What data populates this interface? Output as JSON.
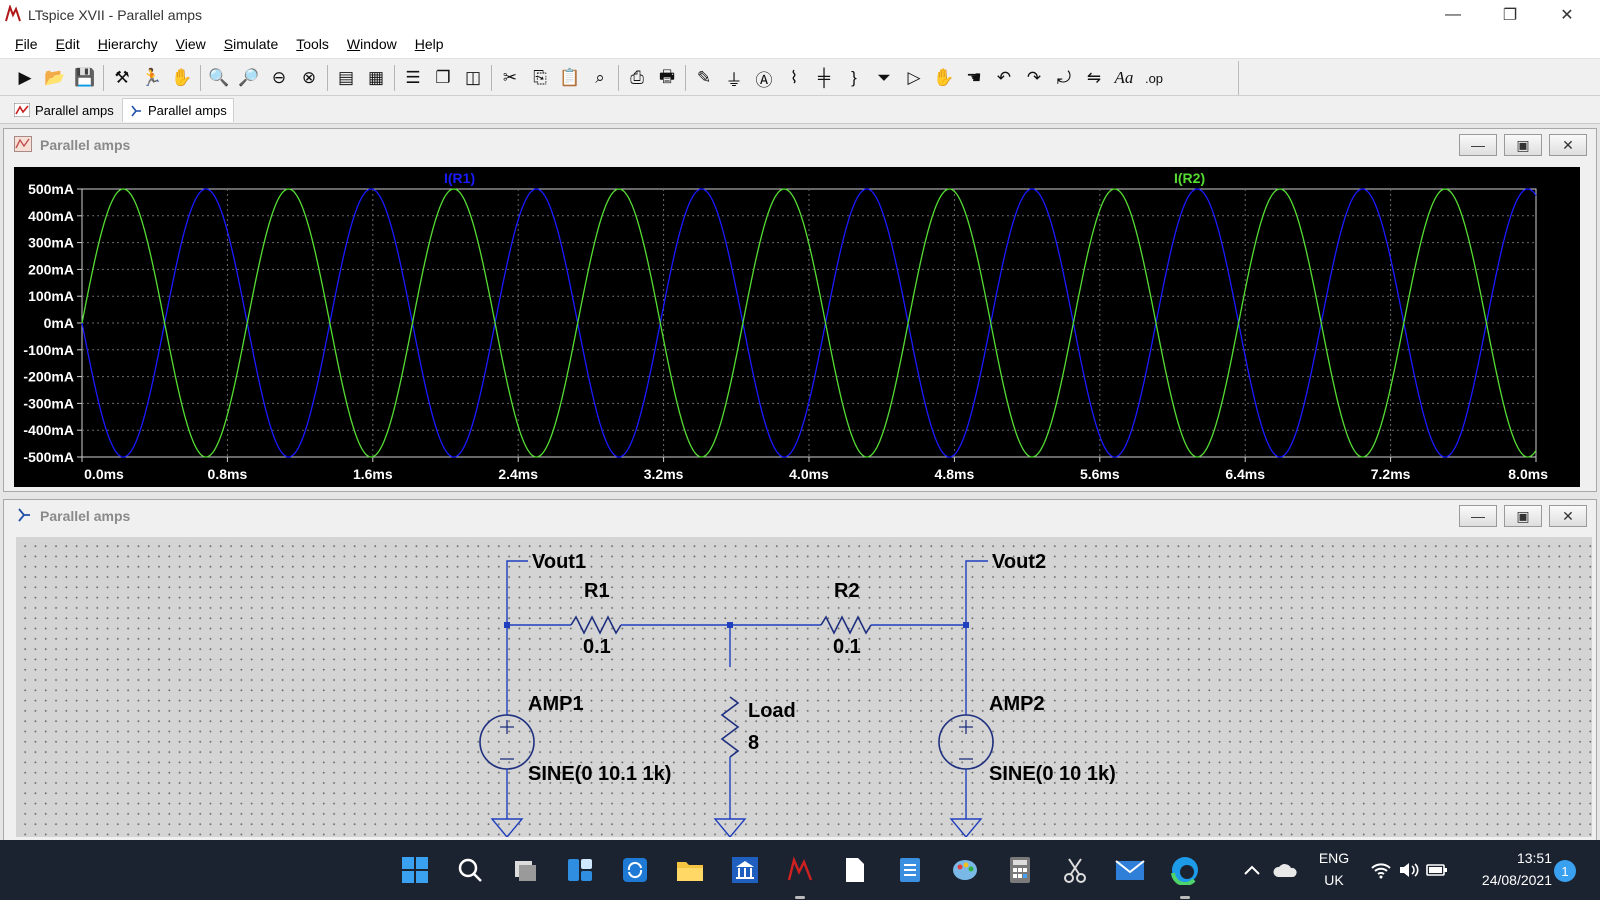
{
  "window": {
    "title": "LTspice XVII - Parallel amps"
  },
  "menu": [
    "File",
    "Edit",
    "Hierarchy",
    "View",
    "Simulate",
    "Tools",
    "Window",
    "Help"
  ],
  "menu_underline": [
    "F",
    "E",
    "H",
    "V",
    "S",
    "T",
    "W",
    "H"
  ],
  "doc_tabs": [
    {
      "label": "Parallel amps",
      "icon": "waveform-icon"
    },
    {
      "label": "Parallel amps",
      "icon": "schematic-icon"
    }
  ],
  "plot_window": {
    "title": "Parallel amps"
  },
  "schematic_window": {
    "title": "Parallel amps"
  },
  "chart_data": {
    "type": "line",
    "x": {
      "min": 0,
      "max": 8,
      "unit": "ms",
      "ticks": [
        "0.0ms",
        "0.8ms",
        "1.6ms",
        "2.4ms",
        "3.2ms",
        "4.0ms",
        "4.8ms",
        "5.6ms",
        "6.4ms",
        "7.2ms",
        "8.0ms"
      ]
    },
    "y": {
      "min": -500,
      "max": 500,
      "unit": "mA",
      "ticks": [
        "500mA",
        "400mA",
        "300mA",
        "200mA",
        "100mA",
        "0mA",
        "-100mA",
        "-200mA",
        "-300mA",
        "-400mA",
        "-500mA"
      ]
    },
    "grid": true,
    "series": [
      {
        "name": "I(R1)",
        "color": "#1a1aff",
        "amplitude_mA": 500,
        "frequency_kHz": 1.1,
        "phase": "starts at 0, decreasing"
      },
      {
        "name": "I(R2)",
        "color": "#55dd33",
        "amplitude_mA": 500,
        "frequency_kHz": 1.1,
        "phase": "starts at 0, increasing"
      }
    ]
  },
  "schematic": {
    "labels": {
      "vout1": "Vout1",
      "vout2": "Vout2",
      "r1": "R1",
      "r1_val": "0.1",
      "r2": "R2",
      "r2_val": "0.1",
      "load": "Load",
      "load_val": "8",
      "amp1": "AMP1",
      "amp1_val": "SINE(0 10.1 1k)",
      "amp2": "AMP2",
      "amp2_val": "SINE(0 10 1k)"
    }
  },
  "taskbar": {
    "lang": "ENG",
    "region": "UK",
    "time": "13:51",
    "date": "24/08/2021",
    "notifications": "1"
  }
}
